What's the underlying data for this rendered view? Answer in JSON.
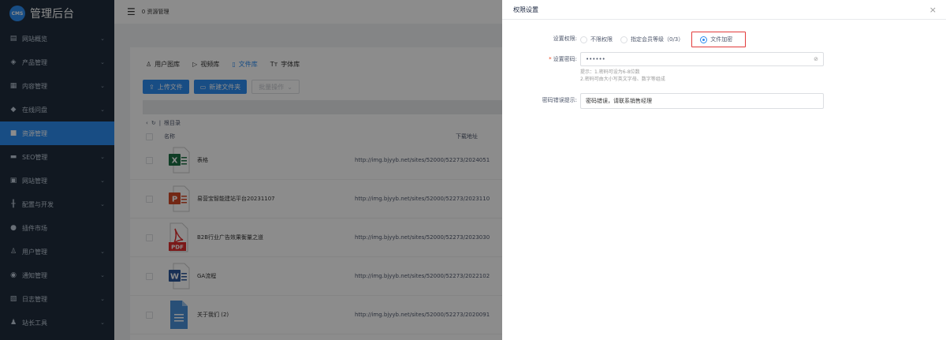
{
  "sidebar": {
    "logo_text": "CMS",
    "title": "管理后台",
    "items": [
      {
        "label": "网站概览",
        "icon": "dashboard-icon",
        "glyph": "▤",
        "active": false,
        "has_chevron": true
      },
      {
        "label": "产品管理",
        "icon": "box-icon",
        "glyph": "◈",
        "active": false,
        "has_chevron": true
      },
      {
        "label": "内容管理",
        "icon": "document-icon",
        "glyph": "▦",
        "active": false,
        "has_chevron": true
      },
      {
        "label": "在线问盘",
        "icon": "chat-icon",
        "glyph": "◆",
        "active": false,
        "has_chevron": true
      },
      {
        "label": "资源管理",
        "icon": "folder-icon",
        "glyph": "■",
        "active": true,
        "has_chevron": false
      },
      {
        "label": "SEO管理",
        "icon": "monitor-icon",
        "glyph": "▬",
        "active": false,
        "has_chevron": true
      },
      {
        "label": "网站管理",
        "icon": "window-icon",
        "glyph": "▣",
        "active": false,
        "has_chevron": true
      },
      {
        "label": "配置与开发",
        "icon": "sliders-icon",
        "glyph": "╫",
        "active": false,
        "has_chevron": true
      },
      {
        "label": "插件市场",
        "icon": "lock-icon",
        "glyph": "●",
        "active": false,
        "has_chevron": false
      },
      {
        "label": "用户管理",
        "icon": "user-icon",
        "glyph": "♙",
        "active": false,
        "has_chevron": true
      },
      {
        "label": "通知管理",
        "icon": "bell-icon",
        "glyph": "◉",
        "active": false,
        "has_chevron": true
      },
      {
        "label": "日志管理",
        "icon": "log-icon",
        "glyph": "▧",
        "active": false,
        "has_chevron": true
      },
      {
        "label": "站长工具",
        "icon": "tools-icon",
        "glyph": "♟",
        "active": false,
        "has_chevron": true
      }
    ]
  },
  "topbar": {
    "menu_icon": "menu-fold-icon",
    "breadcrumb": "0 资源管理"
  },
  "tabs": [
    {
      "label": "用户图库",
      "icon": "user-gallery-icon",
      "glyph": "♙",
      "active": false
    },
    {
      "label": "视频库",
      "icon": "video-icon",
      "glyph": "▷",
      "active": false
    },
    {
      "label": "文件库",
      "icon": "file-icon",
      "glyph": "▯",
      "active": true
    },
    {
      "label": "字体库",
      "icon": "font-icon",
      "glyph": "Tт",
      "active": false
    }
  ],
  "actions": {
    "upload": "上传文件",
    "new_folder": "新建文件夹",
    "batch": "批量操作"
  },
  "path": {
    "label": "根目录"
  },
  "table": {
    "col_name": "名称",
    "col_url": "下载地址",
    "rows": [
      {
        "name": "表格",
        "type": "excel",
        "url": "http://img.bjyyb.net/sites/52000/52273/2024051"
      },
      {
        "name": "易营宝智能建站平台20231107",
        "type": "ppt",
        "url": "http://img.bjyyb.net/sites/52000/52273/2023110"
      },
      {
        "name": "B2B行业广告效果衡量之道",
        "type": "pdf",
        "url": "http://img.bjyyb.net/sites/52000/52273/2023030"
      },
      {
        "name": "GA流程",
        "type": "word",
        "url": "http://img.bjyyb.net/sites/52000/52273/2022102"
      },
      {
        "name": "关于我们 (2)",
        "type": "doc",
        "url": "http://img.bjyyb.net/sites/52000/52273/2020091"
      }
    ]
  },
  "drawer": {
    "title": "权限设置",
    "close": "×",
    "permission_label": "设置权限:",
    "options": [
      {
        "label": "不限权限",
        "checked": false
      },
      {
        "label": "指定会员等级（0/3）",
        "checked": false
      },
      {
        "label": "文件加密",
        "checked": true
      }
    ],
    "password_label": "设置密码:",
    "password_value": "••••••",
    "eye_icon": "eye-off-icon",
    "hint_line1": "提示：1.密码可设为6-8位数",
    "hint_line2": "2.密码可由大小写英文字母、数字等组成",
    "error_hint_label": "密码错误提示:",
    "error_hint_value": "密码错误，请联系销售经理"
  }
}
